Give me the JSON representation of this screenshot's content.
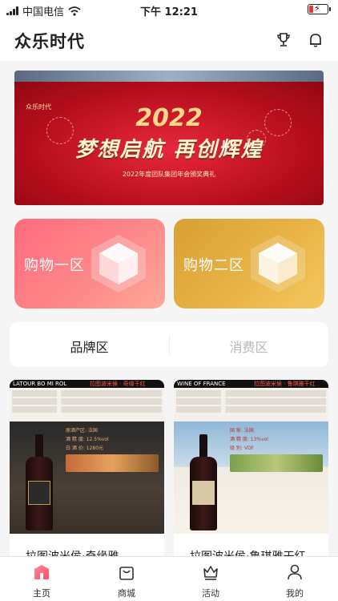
{
  "statusbar": {
    "carrier": "中国电信",
    "time": "下午 12:21"
  },
  "header": {
    "title": "众乐时代",
    "icons": [
      "trophy-icon",
      "bell-icon"
    ]
  },
  "banner": {
    "year": "2022",
    "slogan": "梦想启航 再创辉煌",
    "subtitle": "2022年度团队集团年会颁奖典礼",
    "brand": "众乐时代"
  },
  "categories": [
    {
      "label": "购物一区",
      "color_from": "#ff6b7d",
      "color_to": "#ffa998"
    },
    {
      "label": "购物二区",
      "color_from": "#d9a035",
      "color_to": "#f3c65e"
    }
  ],
  "tabs": {
    "brand": "品牌区",
    "consume": "消费区",
    "active": "brand"
  },
  "products": [
    {
      "poster_title": "LATOUR BO MI ROL",
      "poster_tag": "拉图波米侯 · 奇缘干红",
      "region_label": "原酒产区: 法国",
      "alcohol": "酒 精 度: 12.5%vol",
      "price": "白 酒 价: 1280元",
      "name": "拉图波米侯·奇缘雅"
    },
    {
      "poster_title": "WINE OF FRANCE",
      "poster_tag": "拉图波米侯 · 鲁琪雅干红",
      "region_label": "国 家: 法国",
      "alcohol": "酒 精 度: 13%vol",
      "price": "级 别: VDF",
      "name": "拉图波米侯·鲁琪雅干红"
    }
  ],
  "tabbar": [
    {
      "label": "主页",
      "icon": "home-icon",
      "active": true
    },
    {
      "label": "商城",
      "icon": "shopping-bag-icon",
      "active": false
    },
    {
      "label": "活动",
      "icon": "crown-icon",
      "active": false
    },
    {
      "label": "我的",
      "icon": "user-icon",
      "active": false
    }
  ],
  "colors": {
    "accent": "#ff5a6e",
    "gold": "#e0a83f",
    "banner_red": "#c8121f"
  }
}
